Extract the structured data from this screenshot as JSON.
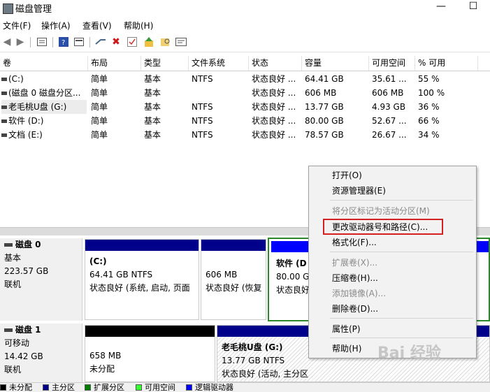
{
  "window": {
    "title": "磁盘管理",
    "minimize": "—",
    "maximize": "☐"
  },
  "menu": [
    "文件(F)",
    "操作(A)",
    "查看(V)",
    "帮助(H)"
  ],
  "volumes": {
    "headers": [
      "卷",
      "布局",
      "类型",
      "文件系统",
      "状态",
      "容量",
      "可用空间",
      "% 可用"
    ],
    "rows": [
      [
        "(C:)",
        "简单",
        "基本",
        "NTFS",
        "状态良好 ...",
        "64.41 GB",
        "35.61 ...",
        "55 %"
      ],
      [
        "(磁盘 0 磁盘分区...",
        "简单",
        "基本",
        "",
        "状态良好 ...",
        "606 MB",
        "606 MB",
        "100 %"
      ],
      [
        "老毛桃U盘 (G:)",
        "简单",
        "基本",
        "NTFS",
        "状态良好 ...",
        "13.77 GB",
        "4.93 GB",
        "36 %"
      ],
      [
        "软件 (D:)",
        "简单",
        "基本",
        "NTFS",
        "状态良好 ...",
        "80.00 GB",
        "52.67 ...",
        "66 %"
      ],
      [
        "文档 (E:)",
        "简单",
        "基本",
        "NTFS",
        "状态良好 ...",
        "78.57 GB",
        "26.67 ...",
        "34 %"
      ]
    ]
  },
  "disks": [
    {
      "name": "磁盘 0",
      "type": "基本",
      "size": "223.57 GB",
      "status": "联机",
      "partitions": [
        {
          "label": "(C:)",
          "line2": "64.41 GB NTFS",
          "line3": "状态良好 (系统, 启动, 页面",
          "bar_color": "#00008b"
        },
        {
          "label": "",
          "line2": "606 MB",
          "line3": "状态良好 (恢复",
          "bar_color": "#00008b"
        },
        {
          "label": "软件 (D",
          "line2": "80.00 G",
          "line3": "状态良好",
          "bar_color": "#0000ff"
        }
      ]
    },
    {
      "name": "磁盘 1",
      "type": "可移动",
      "size": "14.42 GB",
      "status": "联机",
      "partitions": [
        {
          "label": "",
          "line2": "658 MB",
          "line3": "未分配",
          "bar_color": "#000000"
        },
        {
          "label": "老毛桃U盘 (G:)",
          "line2": "13.77 GB NTFS",
          "line3": "状态良好 (活动, 主分区",
          "bar_color": "#00008b"
        }
      ]
    }
  ],
  "legend": [
    {
      "label": "未分配",
      "color": "#000000"
    },
    {
      "label": "主分区",
      "color": "#00008b"
    },
    {
      "label": "扩展分区",
      "color": "#008000"
    },
    {
      "label": "可用空间",
      "color": "#33ff33"
    },
    {
      "label": "逻辑驱动器",
      "color": "#0000ff"
    }
  ],
  "context_menu": {
    "items": [
      "打开(O)",
      "资源管理器(E)",
      "将分区标记为活动分区(M)",
      "更改驱动器号和路径(C)...",
      "格式化(F)...",
      "扩展卷(X)...",
      "压缩卷(H)...",
      "添加镜像(A)...",
      "删除卷(D)...",
      "属性(P)",
      "帮助(H)"
    ],
    "disabled": [
      false,
      false,
      true,
      false,
      false,
      true,
      false,
      true,
      false,
      false,
      false
    ]
  },
  "watermark": "Bai 经验",
  "icons": [
    "back-icon",
    "forward-icon",
    "list-icon",
    "help-icon",
    "view-icon",
    "connect-icon",
    "delete-icon",
    "check-icon",
    "up-icon",
    "search-icon",
    "properties-icon"
  ]
}
